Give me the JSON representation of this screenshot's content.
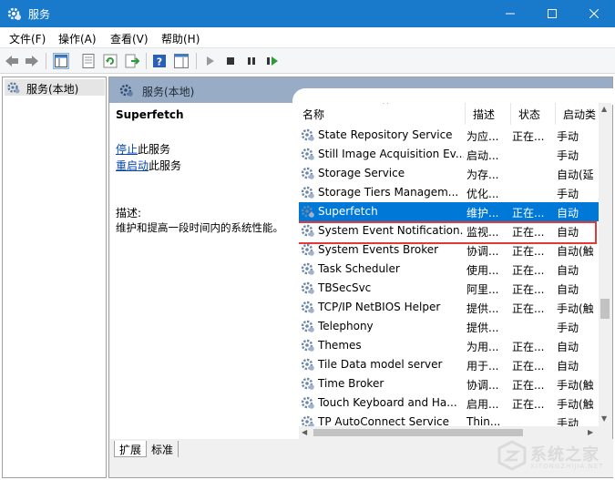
{
  "window": {
    "title": "服务"
  },
  "menu": [
    "文件(F)",
    "操作(A)",
    "查看(V)",
    "帮助(H)"
  ],
  "tree": {
    "root_label": "服务(本地)"
  },
  "header": {
    "label": "服务(本地)"
  },
  "detail": {
    "service_name": "Superfetch",
    "stop_link": "停止",
    "stop_suffix": "此服务",
    "restart_link": "重启动",
    "restart_suffix": "此服务",
    "desc_label": "描述:",
    "desc_text": "维护和提高一段时间内的系统性能。"
  },
  "columns": {
    "name": "名称",
    "description": "描述",
    "status": "状态",
    "startup": "启动类"
  },
  "services": [
    {
      "name": "State Repository Service",
      "desc": "为应...",
      "status": "正在...",
      "startup": "手动"
    },
    {
      "name": "Still Image Acquisition Ev...",
      "desc": "启动...",
      "status": "",
      "startup": "手动"
    },
    {
      "name": "Storage Service",
      "desc": "为存...",
      "status": "",
      "startup": "自动(延"
    },
    {
      "name": "Storage Tiers Managem...",
      "desc": "优化...",
      "status": "",
      "startup": "手动"
    },
    {
      "name": "Superfetch",
      "desc": "维护...",
      "status": "正在...",
      "startup": "自动"
    },
    {
      "name": "System Event Notification...",
      "desc": "监视...",
      "status": "正在...",
      "startup": "自动"
    },
    {
      "name": "System Events Broker",
      "desc": "协调...",
      "status": "正在...",
      "startup": "自动(触"
    },
    {
      "name": "Task Scheduler",
      "desc": "使用...",
      "status": "正在...",
      "startup": "自动"
    },
    {
      "name": "TBSecSvc",
      "desc": "阿里...",
      "status": "正在...",
      "startup": "自动"
    },
    {
      "name": "TCP/IP NetBIOS Helper",
      "desc": "提供...",
      "status": "正在...",
      "startup": "手动(触"
    },
    {
      "name": "Telephony",
      "desc": "提供...",
      "status": "",
      "startup": "手动"
    },
    {
      "name": "Themes",
      "desc": "为用...",
      "status": "正在...",
      "startup": "自动"
    },
    {
      "name": "Tile Data model server",
      "desc": "用于...",
      "status": "正在...",
      "startup": "自动"
    },
    {
      "name": "Time Broker",
      "desc": "协调...",
      "status": "正在...",
      "startup": "手动(触"
    },
    {
      "name": "Touch Keyboard and Ha...",
      "desc": "启用...",
      "status": "正在...",
      "startup": "手动(触"
    },
    {
      "name": "TP AutoConnect Service",
      "desc": "Thin...",
      "status": "",
      "startup": "手动"
    }
  ],
  "selected_index": 4,
  "tabs": [
    "扩展",
    "标准"
  ],
  "watermark": {
    "text": "系统之家",
    "url": "XITONGZHIJIA.NET"
  },
  "colors": {
    "titlebar": "#1979ca",
    "selection": "#0078d7",
    "highlight_box": "#e53935",
    "header_bar": "#98acc5"
  }
}
